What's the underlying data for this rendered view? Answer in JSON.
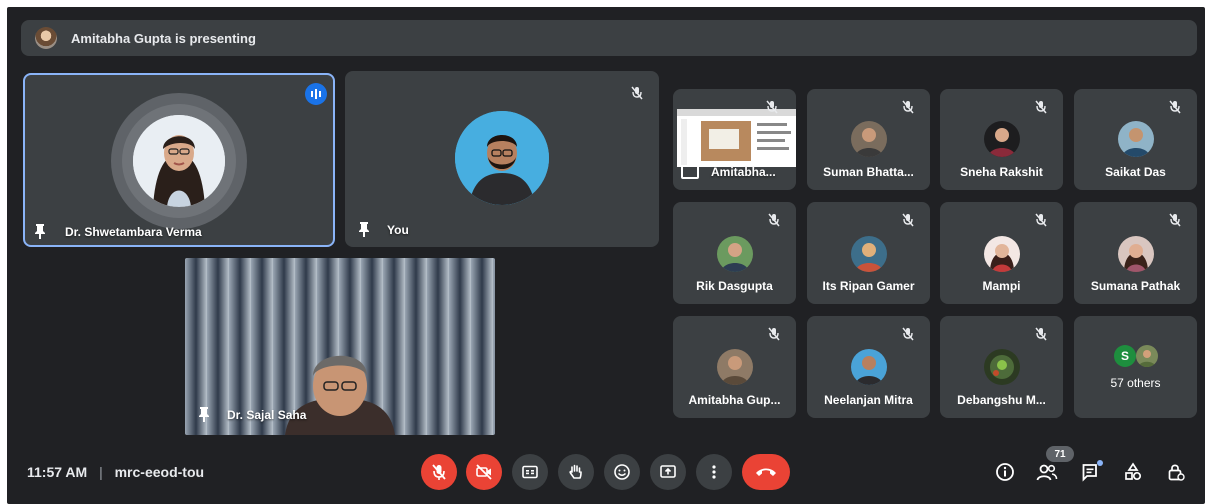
{
  "banner": {
    "text": "Amitabha Gupta is presenting"
  },
  "main_tiles": {
    "speaker": {
      "name": "Dr. Shwetambara Verma"
    },
    "self": {
      "name": "You"
    },
    "camera": {
      "name": "Dr. Sajal Saha"
    }
  },
  "grid": [
    {
      "name": "Amitabha...",
      "type": "presentation"
    },
    {
      "name": "Suman Bhatta...",
      "color": "#7a6c5d"
    },
    {
      "name": "Sneha Rakshit",
      "color": "#1d1d1f"
    },
    {
      "name": "Saikat Das",
      "color": "#8fb3c7"
    },
    {
      "name": "Rik Dasgupta",
      "color": "#6b9a5f"
    },
    {
      "name": "Its Ripan Gamer",
      "color": "#3d6e8a"
    },
    {
      "name": "Mampi",
      "color": "#c43a3a"
    },
    {
      "name": "Sumana Pathak",
      "color": "#a0566b"
    },
    {
      "name": "Amitabha Gup...",
      "color": "#8e7a66"
    },
    {
      "name": "Neelanjan Mitra",
      "color": "#4aa3d8"
    },
    {
      "name": "Debangshu M...",
      "color": "#4d6b3a"
    }
  ],
  "others": {
    "initial": "S",
    "label": "57 others",
    "accent": "#1e8e3e"
  },
  "footer": {
    "time": "11:57 AM",
    "separator": "|",
    "meeting_code": "mrc-eeod-tou",
    "participant_count": "71"
  },
  "colors": {
    "background": "#202124",
    "tile": "#3c4043",
    "red": "#ea4335",
    "active_border": "#8ab4f8",
    "badge": "#1a73e8"
  }
}
